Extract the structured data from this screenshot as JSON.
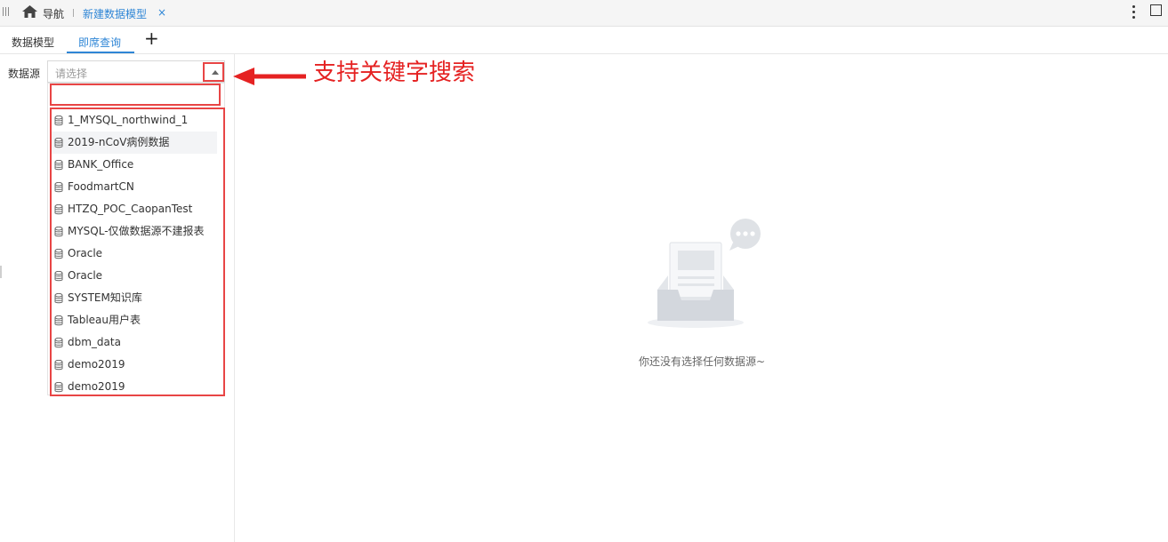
{
  "topbar": {
    "nav_label": "导航",
    "doc_tab_label": "新建数据模型",
    "close_glyph": "×"
  },
  "tabs": {
    "model_label": "数据模型",
    "query_label": "即席查询",
    "add_glyph": "+"
  },
  "datasource": {
    "label": "数据源",
    "placeholder": "请选择",
    "search_value": "",
    "items": [
      "1_MYSQL_northwind_1",
      "2019-nCoV病例数据",
      "BANK_Office",
      "FoodmartCN",
      "HTZQ_POC_CaopanTest",
      "MYSQL-仅做数据源不建报表",
      "Oracle",
      "Oracle",
      "SYSTEM知识库",
      "Tableau用户表",
      "dbm_data",
      "demo2019",
      "demo2019"
    ],
    "item_icon": "database-icon"
  },
  "annotation": {
    "text": "支持关键字搜索",
    "color": "#e52222"
  },
  "empty_state": {
    "message": "你还没有选择任何数据源~"
  },
  "colors": {
    "accent": "#2f86d6",
    "highlight": "#e84545"
  }
}
